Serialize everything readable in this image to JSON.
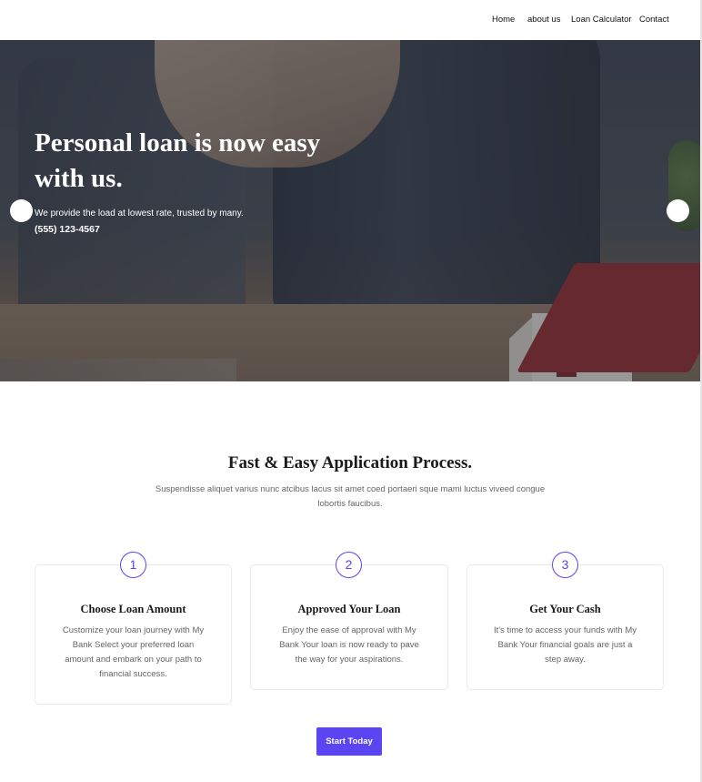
{
  "nav": {
    "items": [
      "Home",
      "about us",
      "Loan Calculator",
      "Contact"
    ]
  },
  "hero": {
    "title": "Personal loan is now easy with us.",
    "subtitle": "We provide the load at lowest rate, trusted by many.",
    "phone": "(555) 123-4567",
    "prev_icon": "circle-prev-arrow-icon",
    "next_icon": "circle-next-arrow-icon"
  },
  "process": {
    "title": "Fast & Easy Application Process.",
    "description": "Suspendisse aliquet varius nunc atcibus lacus sit amet coed portaeri sque mami luctus viveed congue lobortis faucibus.",
    "steps": [
      {
        "number": "1",
        "title": "Choose Loan Amount",
        "text": "Customize your loan journey with My Bank Select your preferred loan amount and embark on your path to financial success."
      },
      {
        "number": "2",
        "title": "Approved Your Loan",
        "text": "Enjoy the ease of approval with My Bank Your loan is now ready to pave the way for your aspirations."
      },
      {
        "number": "3",
        "title": "Get Your Cash",
        "text": "It's time to access your funds with My Bank Your financial goals are just a step away."
      }
    ]
  },
  "cta": {
    "label": "Start Today"
  },
  "colors": {
    "accent": "#5b45f2",
    "heading": "#1a1a1a",
    "body_text": "#666666"
  }
}
